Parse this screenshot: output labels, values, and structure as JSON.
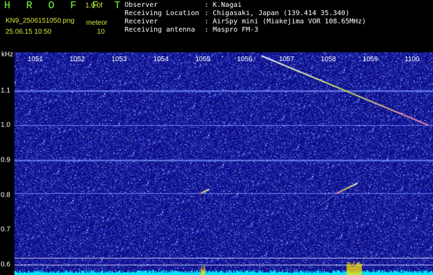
{
  "header": {
    "app_title": "H R O F F T",
    "version": "1.0.0f",
    "filename": "KN9_2506151050.png",
    "datetime": "25.06.15 10:50",
    "mode": "meteor",
    "count": "10",
    "meta": [
      {
        "key": "Observer",
        "value": "K.Nagai"
      },
      {
        "key": "Receiving Location",
        "value": "Chigasaki, Japan (139.414 35.340)"
      },
      {
        "key": "Receiver",
        "value": "AirSpy mini (Miakejima VOR 108.65MHz)"
      },
      {
        "key": "Receiving antenna",
        "value": "Maspro FM-3"
      }
    ]
  },
  "chart_data": {
    "type": "heatmap",
    "title": "",
    "xlabel": "",
    "ylabel": "kHz",
    "x_ticks": [
      "1051",
      "1052",
      "1053",
      "1054",
      "1055",
      "1056",
      "1057",
      "1058",
      "1059",
      "1100"
    ],
    "y_ticks": [
      "1.1",
      "1.0",
      "0.9",
      "0.8",
      "0.7",
      "0.6"
    ],
    "xlim": [
      "1050.5",
      "1100.5"
    ],
    "ylim": [
      0.57,
      1.21
    ],
    "horizontal_lines_khz": [
      1.1,
      1.0,
      0.9,
      0.805,
      0.62,
      0.6
    ],
    "meteor_trails": [
      {
        "start": [
          "1056.4",
          1.2
        ],
        "end": [
          "1100.4",
          1.0
        ]
      },
      {
        "start": [
          "1058.7",
          0.834
        ],
        "end": [
          "1058.2",
          0.805
        ]
      },
      {
        "start": [
          "1055.15",
          0.816
        ],
        "end": [
          "1054.95",
          0.805
        ]
      }
    ],
    "colors": {
      "background": "#0a0a6e",
      "noise": "#3040d0",
      "signal": "#c8e050",
      "baseline": "#00e5ff",
      "burst": "#ffe000"
    }
  }
}
